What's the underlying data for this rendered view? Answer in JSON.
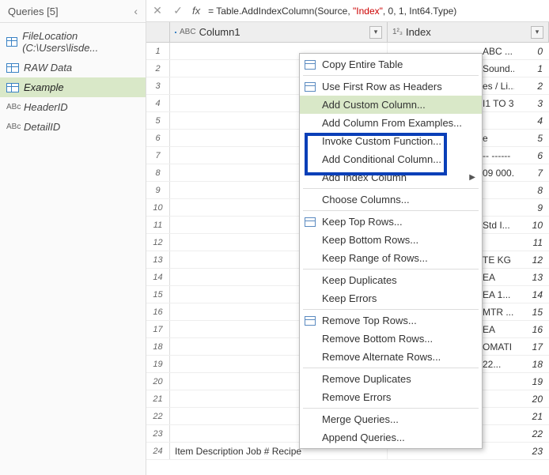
{
  "queries_panel": {
    "title": "Queries [5]",
    "items": [
      {
        "label": "FileLocation (C:\\Users\\lisde...",
        "icon": "table"
      },
      {
        "label": "RAW Data",
        "icon": "table"
      },
      {
        "label": "Example",
        "icon": "table",
        "selected": true
      },
      {
        "label": "HeaderID",
        "icon": "abc"
      },
      {
        "label": "DetailID",
        "icon": "abc"
      }
    ]
  },
  "formula_bar": {
    "prefix": "= Table.AddIndexColumn(Source, ",
    "arg_str": "\"Index\"",
    "mid": ", 0, 1, ",
    "tail": "Int64.Type)"
  },
  "columns": {
    "col1": {
      "type_label": "ABC",
      "name": "Column1"
    },
    "col2": {
      "type_label": "1²₃",
      "name": "Index"
    }
  },
  "context_menu": {
    "items": [
      {
        "label": "Copy Entire Table",
        "icon": "tbl"
      },
      {
        "sep": true
      },
      {
        "label": "Use First Row as Headers",
        "icon": "tbl"
      },
      {
        "label": "Add Custom Column...",
        "hl": true
      },
      {
        "label": "Add Column From Examples..."
      },
      {
        "label": "Invoke Custom Function..."
      },
      {
        "label": "Add Conditional Column..."
      },
      {
        "label": "Add Index Column",
        "submenu": true
      },
      {
        "sep": true
      },
      {
        "label": "Choose Columns..."
      },
      {
        "sep": true
      },
      {
        "label": "Keep Top Rows...",
        "icon": "tbl"
      },
      {
        "label": "Keep Bottom Rows..."
      },
      {
        "label": "Keep Range of Rows..."
      },
      {
        "sep": true
      },
      {
        "label": "Keep Duplicates"
      },
      {
        "label": "Keep Errors"
      },
      {
        "sep": true
      },
      {
        "label": "Remove Top Rows...",
        "icon": "tbl"
      },
      {
        "label": "Remove Bottom Rows..."
      },
      {
        "label": "Remove Alternate Rows..."
      },
      {
        "sep": true
      },
      {
        "label": "Remove Duplicates"
      },
      {
        "label": "Remove Errors"
      },
      {
        "sep": true
      },
      {
        "label": "Merge Queries..."
      },
      {
        "label": "Append Queries..."
      }
    ]
  },
  "rows": [
    {
      "n": 1,
      "c1": "ABC ...",
      "idx": 0
    },
    {
      "n": 2,
      "c1": "Sound...",
      "idx": 1
    },
    {
      "n": 3,
      "c1": "es / Li...",
      "idx": 2
    },
    {
      "n": 4,
      "c1": "I1 TO 3...",
      "idx": 3
    },
    {
      "n": 5,
      "c1": "",
      "idx": 4
    },
    {
      "n": 6,
      "c1": "e",
      "idx": 5
    },
    {
      "n": 7,
      "c1": "-- ------",
      "idx": 6
    },
    {
      "n": 8,
      "c1": "09 000...",
      "idx": 7
    },
    {
      "n": 9,
      "c1": "",
      "idx": 8
    },
    {
      "n": 10,
      "c1": "",
      "idx": 9
    },
    {
      "n": 11,
      "c1": "Std I...",
      "idx": 10
    },
    {
      "n": 12,
      "c1": "",
      "idx": 11
    },
    {
      "n": 13,
      "c1": "TE KG ...",
      "idx": 12
    },
    {
      "n": 14,
      "c1": "EA",
      "idx": 13
    },
    {
      "n": 15,
      "c1": "EA   1...",
      "idx": 14
    },
    {
      "n": 16,
      "c1": "MTR ...",
      "idx": 15
    },
    {
      "n": 17,
      "c1": "EA",
      "idx": 16
    },
    {
      "n": 18,
      "c1": "OMATI",
      "idx": 17
    },
    {
      "n": 19,
      "c1": " 22...",
      "idx": 18
    },
    {
      "n": 20,
      "c1": "",
      "idx": 19
    },
    {
      "n": 21,
      "c1": "",
      "idx": 20
    },
    {
      "n": 22,
      "c1": "",
      "idx": 21
    },
    {
      "n": 23,
      "c1": "",
      "idx": 22
    },
    {
      "n": 24,
      "c1full": "Item       Description           Job #   Recipe",
      "idx": 23
    }
  ]
}
